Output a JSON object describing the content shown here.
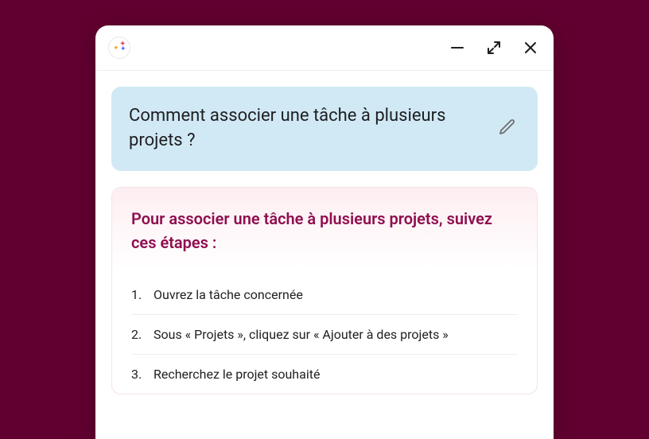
{
  "question": {
    "text": "Comment associer une tâche à plusieurs projets ?"
  },
  "answer": {
    "title": "Pour associer une tâche à plusieurs projets, suivez ces étapes :",
    "steps": [
      "Ouvrez la tâche concernée",
      "Sous « Projets », cliquez sur « Ajouter à des projets »",
      "Recherchez le projet souhaité"
    ]
  }
}
